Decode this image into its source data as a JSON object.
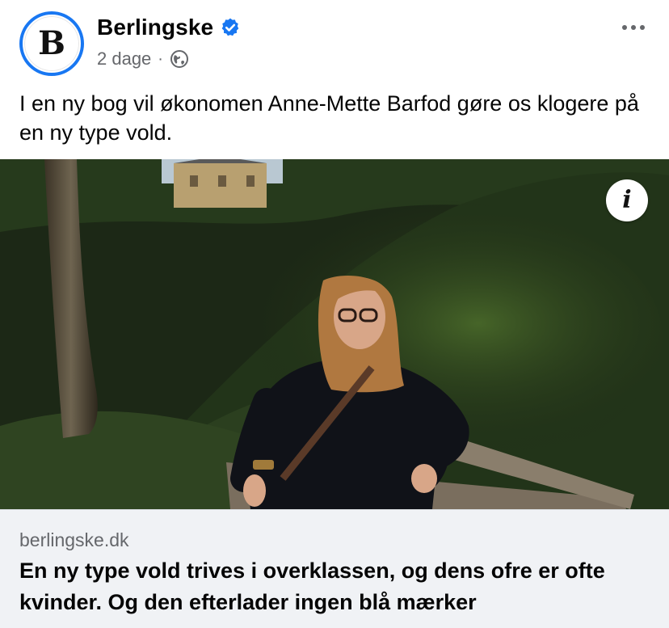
{
  "post": {
    "page_name": "Berlingske",
    "avatar_letter": "B",
    "timestamp": "2 dage",
    "separator": "·",
    "verified_icon": "verified-badge-icon",
    "audience_icon": "globe-icon",
    "text": "I en ny bog vil økonomen Anne-Mette Barfod gøre os klogere på en ny type vold.",
    "colors": {
      "verified": "#1877f2",
      "meta_text": "#65676b",
      "link_bg": "#f0f2f5"
    }
  },
  "photo": {
    "info_label": "i"
  },
  "link_preview": {
    "domain": "berlingske.dk",
    "title": "En ny type vold trives i overklassen, og dens ofre er ofte kvinder. Og den efterlader ingen blå mærker"
  }
}
